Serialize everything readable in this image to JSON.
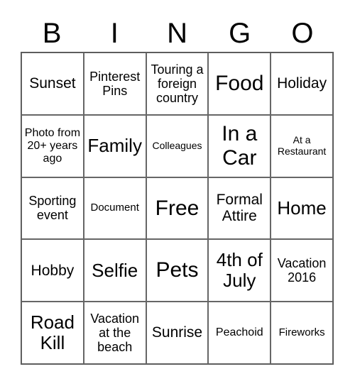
{
  "header": [
    "B",
    "I",
    "N",
    "G",
    "O"
  ],
  "cells": [
    "Sunset",
    "Pinterest Pins",
    "Touring a foreign country",
    "Food",
    "Holiday",
    "Photo from 20+ years ago",
    "Family",
    "Colleagues",
    "In a Car",
    "At a Restaurant",
    "Sporting event",
    "Document",
    "Free",
    "Formal Attire",
    "Home",
    "Hobby",
    "Selfie",
    "Pets",
    "4th of July",
    "Vacation 2016",
    "Road Kill",
    "Vacation at the beach",
    "Sunrise",
    "Peachoid",
    "Fireworks"
  ]
}
